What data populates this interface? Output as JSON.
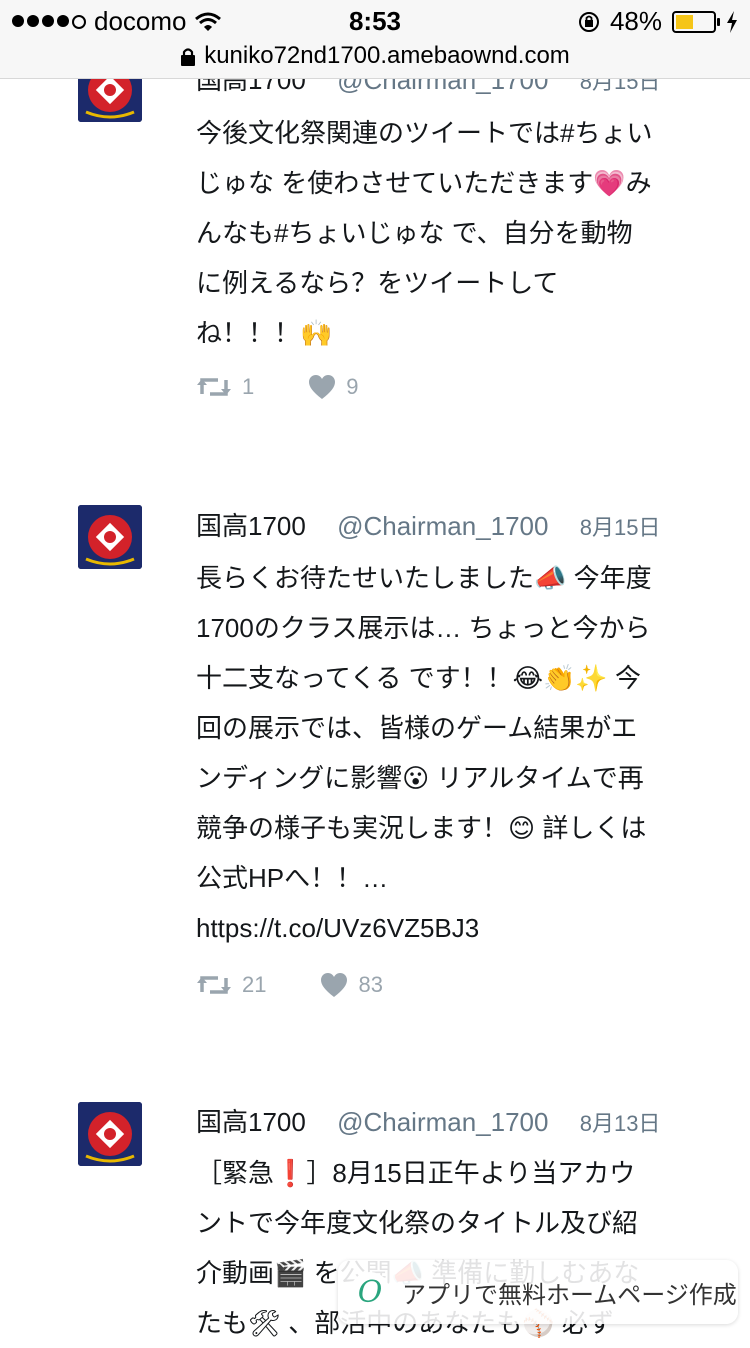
{
  "status_bar": {
    "carrier": "docomo",
    "time": "8:53",
    "battery_percent": "48%",
    "battery_level": 0.48
  },
  "url_bar": {
    "url": "kuniko72nd1700.amebaownd.com"
  },
  "tweets": [
    {
      "name": "国高1700",
      "handle": "@Chairman_1700",
      "date": "8月15日",
      "lines": [
        "今後文化祭関連のツイートでは#ちょい",
        "じゅな を使わさせていただきます💗み",
        "んなも#ちょいじゅな で、自分を動物",
        "に例えるなら？をツイートして",
        "ね！！！🙌"
      ],
      "retweets": "1",
      "likes": "9"
    },
    {
      "name": "国高1700",
      "handle": "@Chairman_1700",
      "date": "8月15日",
      "lines": [
        "長らくお待たせいたしました📣 今年度",
        "1700のクラス展示は… ちょっと今から",
        "十二支なってくる です！！😂👏✨ 今",
        "回の展示では、皆様のゲーム結果がエ",
        "ンディングに影響😮 リアルタイムで再",
        "競争の様子も実況します！😊 詳しくは",
        "公式HPへ！！…",
        "https://t.co/UVz6VZ5BJ3"
      ],
      "retweets": "21",
      "likes": "83"
    },
    {
      "name": "国高1700",
      "handle": "@Chairman_1700",
      "date": "8月13日",
      "lines": [
        "［緊急❗］8月15日正午より当アカウ",
        "ントで今年度文化祭のタイトル及び紹",
        "介動画🎬 を公開📣 準備に勤しむあな",
        "たも🛠 、部活中のあなたも⚾ 必ず"
      ]
    }
  ],
  "banner": {
    "text": "アプリで無料ホームページ作成",
    "logo": "O"
  }
}
